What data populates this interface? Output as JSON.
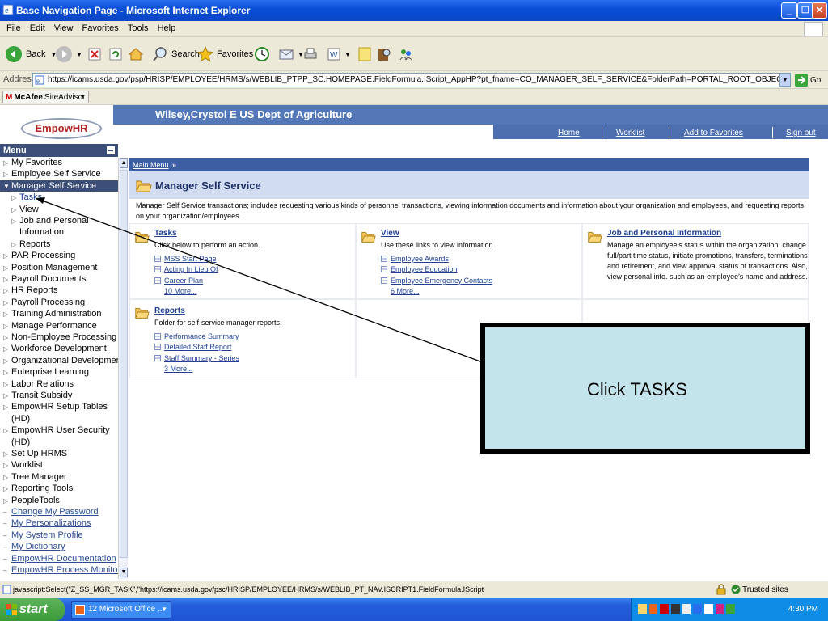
{
  "window": {
    "title": "Base Navigation Page - Microsoft Internet Explorer"
  },
  "menubar": {
    "items": [
      "File",
      "Edit",
      "View",
      "Favorites",
      "Tools",
      "Help"
    ]
  },
  "toolbar": {
    "back": "Back",
    "search": "Search",
    "favorites": "Favorites"
  },
  "address": {
    "label": "Address",
    "url": "https://icams.usda.gov/psp/HRISP/EMPLOYEE/HRMS/s/WEBLIB_PTPP_SC.HOMEPAGE.FieldFormula.IScript_AppHP?pt_fname=CO_MANAGER_SELF_SERVICE&FolderPath=PORTAL_ROOT_OBJECT.CO_MANAGER_SELF_SERVICE&IsFolde",
    "go": "Go"
  },
  "mcafee": {
    "brand": "McAfee",
    "label": "SiteAdvisor"
  },
  "header": {
    "logo": "EmpowHR",
    "user": "Wilsey,Crystol E  US Dept of Agriculture",
    "links": [
      "Home",
      "Worklist",
      "Add to Favorites",
      "Sign out"
    ]
  },
  "menu": {
    "title": "Menu",
    "items": [
      {
        "label": "My Favorites",
        "kind": "folder"
      },
      {
        "label": "Employee Self Service",
        "kind": "folder"
      },
      {
        "label": "Manager Self Service",
        "kind": "open-folder"
      },
      {
        "label": "Tasks",
        "kind": "subfolder"
      },
      {
        "label": "View",
        "kind": "subfolder"
      },
      {
        "label": "Job and Personal",
        "kind": "subfolder"
      },
      {
        "label": "Information",
        "kind": "continuation"
      },
      {
        "label": "Reports",
        "kind": "subfolder"
      },
      {
        "label": "PAR Processing",
        "kind": "folder"
      },
      {
        "label": "Position Management",
        "kind": "folder"
      },
      {
        "label": "Payroll Documents",
        "kind": "folder"
      },
      {
        "label": "HR Reports",
        "kind": "folder"
      },
      {
        "label": "Payroll Processing",
        "kind": "folder"
      },
      {
        "label": "Training Administration",
        "kind": "folder"
      },
      {
        "label": "Manage Performance",
        "kind": "folder"
      },
      {
        "label": "Non-Employee Processing",
        "kind": "folder"
      },
      {
        "label": "Workforce Development",
        "kind": "folder"
      },
      {
        "label": "Organizational Development",
        "kind": "folder"
      },
      {
        "label": "Enterprise Learning",
        "kind": "folder"
      },
      {
        "label": "Labor Relations",
        "kind": "folder"
      },
      {
        "label": "Transit Subsidy",
        "kind": "folder"
      },
      {
        "label": "EmpowHR Setup Tables",
        "kind": "folder"
      },
      {
        "label": "(HD)",
        "kind": "continuation"
      },
      {
        "label": "EmpowHR User Security",
        "kind": "folder"
      },
      {
        "label": "(HD)",
        "kind": "continuation"
      },
      {
        "label": "Set Up HRMS",
        "kind": "folder"
      },
      {
        "label": "Worklist",
        "kind": "folder"
      },
      {
        "label": "Tree Manager",
        "kind": "folder"
      },
      {
        "label": "Reporting Tools",
        "kind": "folder"
      },
      {
        "label": "PeopleTools",
        "kind": "folder"
      },
      {
        "label": "Change My Password",
        "kind": "link"
      },
      {
        "label": "My Personalizations",
        "kind": "link"
      },
      {
        "label": "My System Profile",
        "kind": "link"
      },
      {
        "label": "My Dictionary",
        "kind": "link"
      },
      {
        "label": "EmpowHR Documentation",
        "kind": "link"
      },
      {
        "label": "EmpowHR Process Monitor",
        "kind": "link"
      }
    ]
  },
  "breadcrumb": {
    "main_menu": "Main Menu",
    "sep": "»"
  },
  "mss": {
    "title": "Manager Self Service",
    "description": "Manager Self Service transactions; includes requesting various kinds of personnel transactions, viewing information documents and information about your organization and employees, and requesting reports on your organization/employees."
  },
  "sections": {
    "tasks": {
      "title": "Tasks",
      "desc": "Click below to perform an action.",
      "links": [
        "MSS Start Page",
        "Acting In Lieu Of",
        "Career Plan"
      ],
      "more": "10 More..."
    },
    "view": {
      "title": "View",
      "desc": "Use these links to view information",
      "links": [
        "Employee Awards",
        "Employee Education",
        "Employee Emergency Contacts"
      ],
      "more": "6 More..."
    },
    "job": {
      "title": "Job and Personal Information",
      "desc": "Manage an employee's status within the organization; change full/part time status, initiate promotions, transfers, terminations and retirement, and view approval status of transactions. Also, view personal info. such as an employee's name and address."
    },
    "reports": {
      "title": "Reports",
      "desc": "Folder for self-service manager reports.",
      "links": [
        "Performance Summary",
        "Detailed Staff Report",
        "Staff Summary - Series"
      ],
      "more": "3 More..."
    }
  },
  "callout": {
    "text": "Click TASKS"
  },
  "status": {
    "text": "javascript:Select(\"Z_SS_MGR_TASK\",\"https://icams.usda.gov/psc/HRISP/EMPLOYEE/HRMS/s/WEBLIB_PT_NAV.ISCRIPT1.FieldFormula.IScript",
    "zone": "Trusted sites"
  },
  "taskbar": {
    "start": "start",
    "item": "12 Microsoft Office ...",
    "clock": "4:30 PM"
  },
  "colors": {
    "banner": "#5477b8",
    "menu_selected": "#3c4f79",
    "link": "#1f3f95",
    "callout": "#c4e4ec"
  }
}
